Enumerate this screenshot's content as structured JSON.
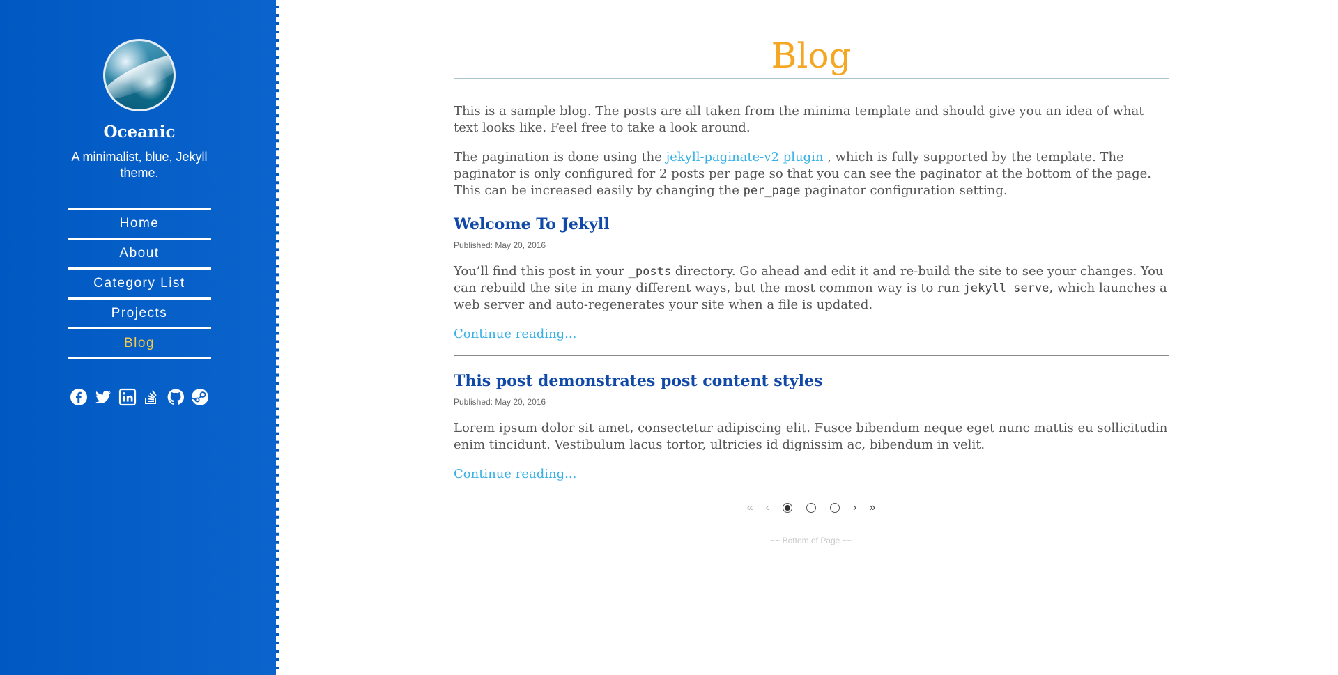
{
  "sidebar": {
    "site_title": "Oceanic",
    "site_description": "A minimalist, blue, Jekyll theme.",
    "nav": [
      {
        "label": "Home"
      },
      {
        "label": "About"
      },
      {
        "label": "Category List"
      },
      {
        "label": "Projects"
      },
      {
        "label": "Blog",
        "active": true
      }
    ],
    "social_icons": [
      "facebook-icon",
      "twitter-icon",
      "linkedin-icon",
      "stackoverflow-icon",
      "github-icon",
      "steam-icon"
    ],
    "colors": {
      "background": "#0059c2",
      "active_nav": "#f2c94c"
    }
  },
  "main": {
    "title": "Blog",
    "intro": {
      "p1": "This is a sample blog. The posts are all taken from the minima template and should give you an idea of what text looks like. Feel free to take a look around.",
      "p2_before_link": "The pagination is done using the ",
      "p2_link": "jekyll-paginate-v2 plugin ",
      "p2_after_link": ", which is fully supported by the template. The paginator is only configured for 2 posts per page so that you can see the paginator at the bottom of the page. This can be increased easily by changing the ",
      "p2_code": "per_page",
      "p2_end": " paginator configuration setting."
    },
    "posts": [
      {
        "title": "Welcome To Jekyll",
        "meta": "Published: May 20, 2016",
        "excerpt_1": "You’ll find this post in your ",
        "excerpt_code_1": "_posts",
        "excerpt_2": " directory. Go ahead and edit it and re-build the site to see your changes. You can rebuild the site in many different ways, but the most common way is to run ",
        "excerpt_code_2": "jekyll serve",
        "excerpt_3": ", which launches a web server and auto-regenerates your site when a file is updated.",
        "continue": "Continue reading..."
      },
      {
        "title": "This post demonstrates post content styles",
        "meta": "Published: May 20, 2016",
        "excerpt": "Lorem ipsum dolor sit amet, consectetur adipiscing elit. Fusce bibendum neque eget nunc mattis eu sollicitudin enim tincidunt. Vestibulum lacus tortor, ultricies id dignissim ac, bibendum in velit.",
        "continue": "Continue reading..."
      }
    ],
    "pagination": {
      "first": "«",
      "prev": "‹",
      "next": "›",
      "last": "»",
      "pages": 3,
      "current": 1
    },
    "bottom_note": "~~ Bottom of Page ~~",
    "colors": {
      "title": "#f5a623",
      "post_title": "#1049a8",
      "link": "#36b0e6"
    }
  }
}
